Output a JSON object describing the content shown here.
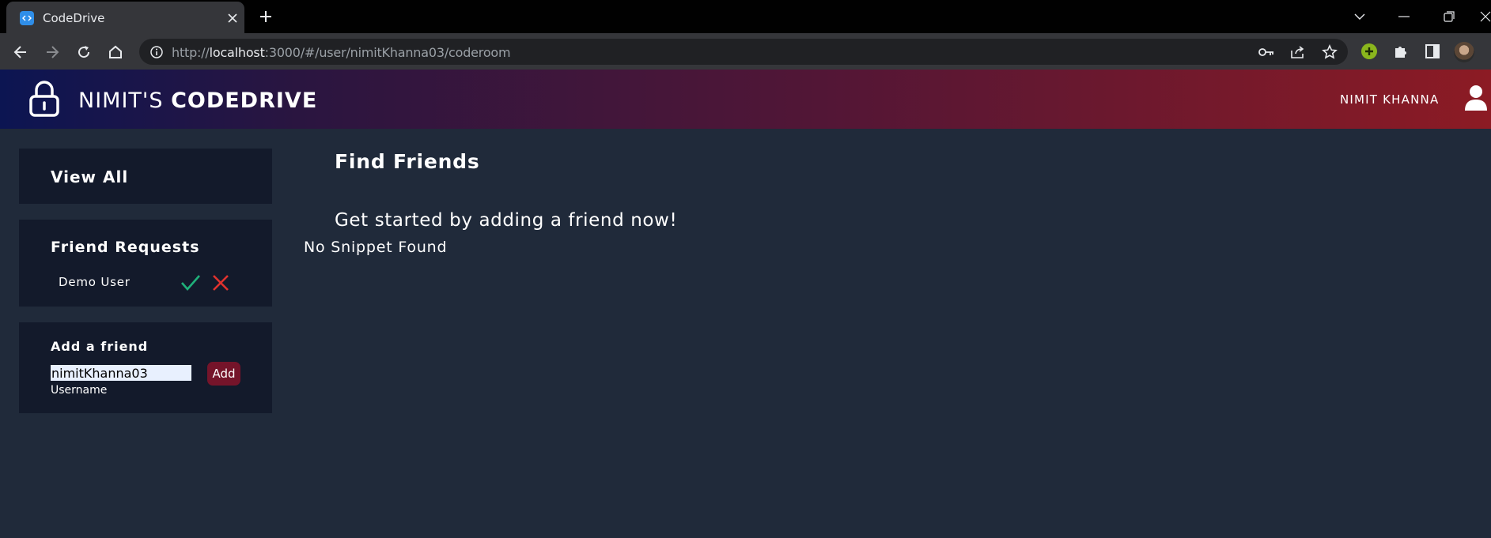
{
  "browser": {
    "tab_title": "CodeDrive",
    "url_prefix": "http://",
    "url_host": "localhost",
    "url_rest": ":3000/#/user/nimitKhanna03/coderoom"
  },
  "header": {
    "brand_light": "NIMIT'S ",
    "brand_bold": "CODEDRIVE",
    "username": "NIMIT KHANNA"
  },
  "sidebar": {
    "view_all_label": "View All",
    "friend_requests": {
      "title": "Friend Requests",
      "items": [
        {
          "name": "Demo User"
        }
      ]
    },
    "add_friend": {
      "title": "Add a friend",
      "input_value": "nimitKhanna03",
      "input_label": "Username",
      "button_label": "Add"
    }
  },
  "main": {
    "title": "Find Friends",
    "subtitle": "Get started by adding a friend now!",
    "empty_message": "No Snippet Found"
  },
  "colors": {
    "page_bg": "#202a3a",
    "card_bg": "#131a2b",
    "accept": "#1fb07a",
    "reject": "#e0322e",
    "add_button": "#75142a"
  }
}
